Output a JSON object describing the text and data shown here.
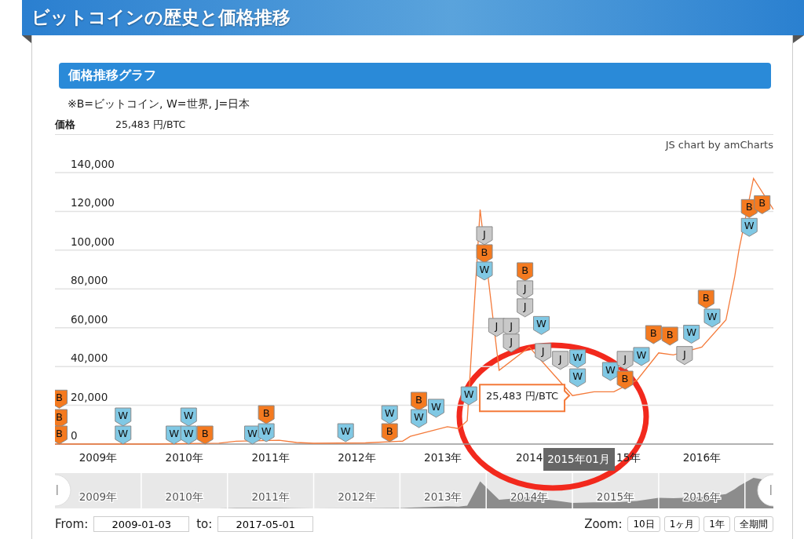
{
  "header": {
    "title": "ビットコインの歴史と価格推移"
  },
  "section": {
    "title": "価格推移グラフ",
    "legend_note": "※B=ビットコイン, W=世界, J=日本"
  },
  "price": {
    "label": "価格",
    "value": "25,483 円/BTC"
  },
  "credit": "JS chart by amCharts",
  "chart": {
    "cursor": {
      "date_label": "2015年01月",
      "value_label": "25,483 円/BTC"
    },
    "axis_fragment": "15年",
    "events": [
      {
        "label": "B",
        "color": "#f47a20"
      },
      {
        "label": "B",
        "color": "#f47a20"
      },
      {
        "label": "B",
        "color": "#f47a20"
      },
      {
        "label": "W",
        "color": "#80c8e4"
      },
      {
        "label": "W",
        "color": "#80c8e4"
      },
      {
        "label": "W",
        "color": "#80c8e4"
      },
      {
        "label": "W",
        "color": "#80c8e4"
      },
      {
        "label": "W",
        "color": "#80c8e4"
      },
      {
        "label": "B",
        "color": "#f47a20"
      },
      {
        "label": "W",
        "color": "#80c8e4"
      },
      {
        "label": "B",
        "color": "#f47a20"
      },
      {
        "label": "W",
        "color": "#80c8e4"
      },
      {
        "label": "W",
        "color": "#80c8e4"
      },
      {
        "label": "W",
        "color": "#80c8e4"
      },
      {
        "label": "B",
        "color": "#f47a20"
      },
      {
        "label": "B",
        "color": "#f47a20"
      },
      {
        "label": "W",
        "color": "#80c8e4"
      },
      {
        "label": "W",
        "color": "#80c8e4"
      },
      {
        "label": "W",
        "color": "#80c8e4"
      },
      {
        "label": "J",
        "color": "#c8c8c8"
      },
      {
        "label": "B",
        "color": "#f47a20"
      },
      {
        "label": "W",
        "color": "#80c8e4"
      },
      {
        "label": "J",
        "color": "#c8c8c8"
      },
      {
        "label": "J",
        "color": "#c8c8c8"
      },
      {
        "label": "J",
        "color": "#c8c8c8"
      },
      {
        "label": "B",
        "color": "#f47a20"
      },
      {
        "label": "J",
        "color": "#c8c8c8"
      },
      {
        "label": "J",
        "color": "#c8c8c8"
      },
      {
        "label": "W",
        "color": "#80c8e4"
      },
      {
        "label": "J",
        "color": "#c8c8c8"
      },
      {
        "label": "J",
        "color": "#c8c8c8"
      },
      {
        "label": "W",
        "color": "#80c8e4"
      },
      {
        "label": "W",
        "color": "#80c8e4"
      },
      {
        "label": "W",
        "color": "#80c8e4"
      },
      {
        "label": "J",
        "color": "#c8c8c8"
      },
      {
        "label": "B",
        "color": "#f47a20"
      },
      {
        "label": "W",
        "color": "#80c8e4"
      },
      {
        "label": "B",
        "color": "#f47a20"
      },
      {
        "label": "B",
        "color": "#f47a20"
      },
      {
        "label": "J",
        "color": "#c8c8c8"
      },
      {
        "label": "W",
        "color": "#80c8e4"
      },
      {
        "label": "B",
        "color": "#f47a20"
      },
      {
        "label": "W",
        "color": "#80c8e4"
      },
      {
        "label": "B",
        "color": "#f47a20"
      },
      {
        "label": "W",
        "color": "#80c8e4"
      },
      {
        "label": "B",
        "color": "#f47a20"
      }
    ],
    "chart_data": {
      "type": "line",
      "grid": true,
      "xlim": [
        2009.0,
        2017.33
      ],
      "ylim": [
        0,
        140000
      ],
      "yticks": [
        {
          "value": 0,
          "label": "0"
        },
        {
          "value": 20000,
          "label": "20,000"
        },
        {
          "value": 40000,
          "label": "40,000"
        },
        {
          "value": 60000,
          "label": "60,000"
        },
        {
          "value": 80000,
          "label": "80,000"
        },
        {
          "value": 100000,
          "label": "100,000"
        },
        {
          "value": 120000,
          "label": "120,000"
        },
        {
          "value": 140000,
          "label": "140,000"
        }
      ],
      "xticks": [
        {
          "value": 2009.5,
          "label": "2009年"
        },
        {
          "value": 2010.5,
          "label": "2010年"
        },
        {
          "value": 2011.5,
          "label": "2011年"
        },
        {
          "value": 2012.5,
          "label": "2012年"
        },
        {
          "value": 2013.5,
          "label": "2013年"
        },
        {
          "value": 2014.5,
          "label": "2014"
        },
        {
          "value": 2016.5,
          "label": "2016年"
        }
      ],
      "x": [
        2009.0,
        2010.2,
        2010.9,
        2011.1,
        2011.6,
        2011.8,
        2012.0,
        2012.6,
        2013.03,
        2013.12,
        2013.55,
        2013.68,
        2013.78,
        2013.93,
        2014.15,
        2014.5,
        2014.8,
        2015.0,
        2015.25,
        2015.48,
        2015.75,
        2016.0,
        2016.17,
        2016.5,
        2016.78,
        2016.88,
        2016.93,
        2017.1,
        2017.33
      ],
      "series": [
        {
          "color": "#f47a3a",
          "values": [
            0,
            0,
            500,
            1500,
            2000,
            800,
            400,
            600,
            1500,
            4000,
            9000,
            8000,
            12000,
            121000,
            38000,
            50000,
            35000,
            25000,
            27000,
            27000,
            33000,
            47000,
            46000,
            50000,
            64000,
            86000,
            100000,
            137000,
            121000
          ]
        }
      ]
    }
  },
  "navigator": {
    "labels": [
      "2009年",
      "2010年",
      "2011年",
      "2012年",
      "2013年",
      "2014年",
      "2015年",
      "2016年"
    ]
  },
  "range": {
    "from_label": "From:",
    "from_value": "2009-01-03",
    "to_label": "to:",
    "to_value": "2017-05-01"
  },
  "zoom": {
    "label": "Zoom:",
    "buttons": [
      "10日",
      "1ヶ月",
      "1年",
      "全期間"
    ]
  }
}
